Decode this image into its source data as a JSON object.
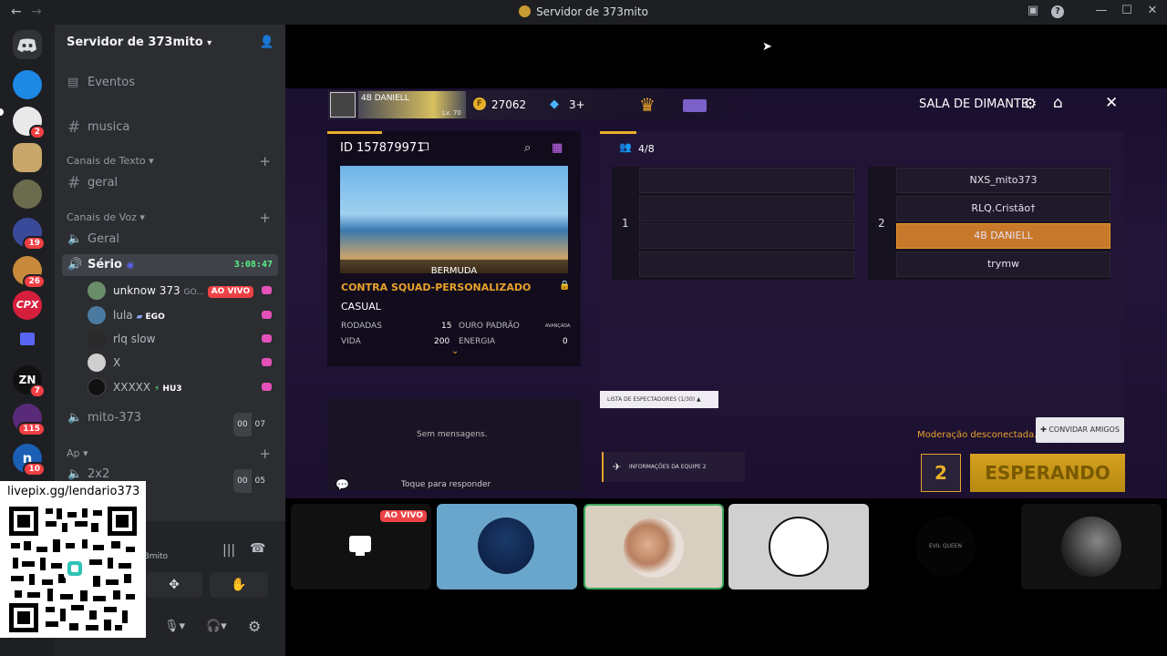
{
  "titlebar": {
    "title": "Servidor de 373mito",
    "back": "←",
    "forward": "→"
  },
  "server_badges": [
    "2",
    "19",
    "26",
    "7",
    "115",
    "10"
  ],
  "sidebar": {
    "server_name": "Servidor de 373mito",
    "events": "Eventos",
    "musica": "musica",
    "text_category": "Canais de Texto",
    "geral": "geral",
    "voice_category": "Canais de Voz",
    "voice_geral": "Geral",
    "serio": "Sério",
    "serio_time": "3:08:47",
    "users": [
      {
        "name": "unknow 373",
        "extra": "GO...",
        "live": "AO VIVO"
      },
      {
        "name": "lula",
        "tag": "EGO"
      },
      {
        "name": "rlq slow"
      },
      {
        "name": "X"
      },
      {
        "name": "XXXXX",
        "tag": "HU3"
      }
    ],
    "mito": "mito-373",
    "mito_count": [
      "00",
      "07"
    ],
    "ap_category": "Ap",
    "x2": "2x2",
    "x2_count": [
      "00",
      "05"
    ],
    "status_fragment": "3mito"
  },
  "qr": {
    "text": "livepix.gg/lendario373"
  },
  "game": {
    "player": "4B   DANIELL",
    "level": "Lv. 70",
    "gold": "27062",
    "diamonds": "3+",
    "room_title": "SALA DE DIMANTE",
    "room_id": "ID 157879971",
    "map": "BERMUDA",
    "mode": "CONTRA SQUAD-PERSONALIZADO",
    "submode": "CASUAL",
    "rodadas_label": "RODADAS",
    "rodadas": "15",
    "ouro_label": "OURO PADRÃO",
    "avancada": "AVANÇADA",
    "vida_label": "VIDA",
    "vida": "200",
    "energia_label": "ENERGIA",
    "energia": "0",
    "players_count": "4/8",
    "team1": "1",
    "team2": "2",
    "team2_players": [
      "NXS_mito373",
      "RLQ.Cristão†",
      "4B   DANIELL",
      "trymw"
    ],
    "spectators": "LISTA DE ESPECTADORES  (1/30)",
    "no_messages": "Sem mensagens.",
    "reply": "Toque para responder",
    "team_info": "INFORMAÇÕES DA EQUIPE 2",
    "moderation": "Moderação desconectada.",
    "invite": "CONVIDAR AMIGOS",
    "waiting": "ESPERANDO"
  },
  "tiles": {
    "live": "AO VIVO",
    "tile5_text": "EVIL QUEEN"
  }
}
